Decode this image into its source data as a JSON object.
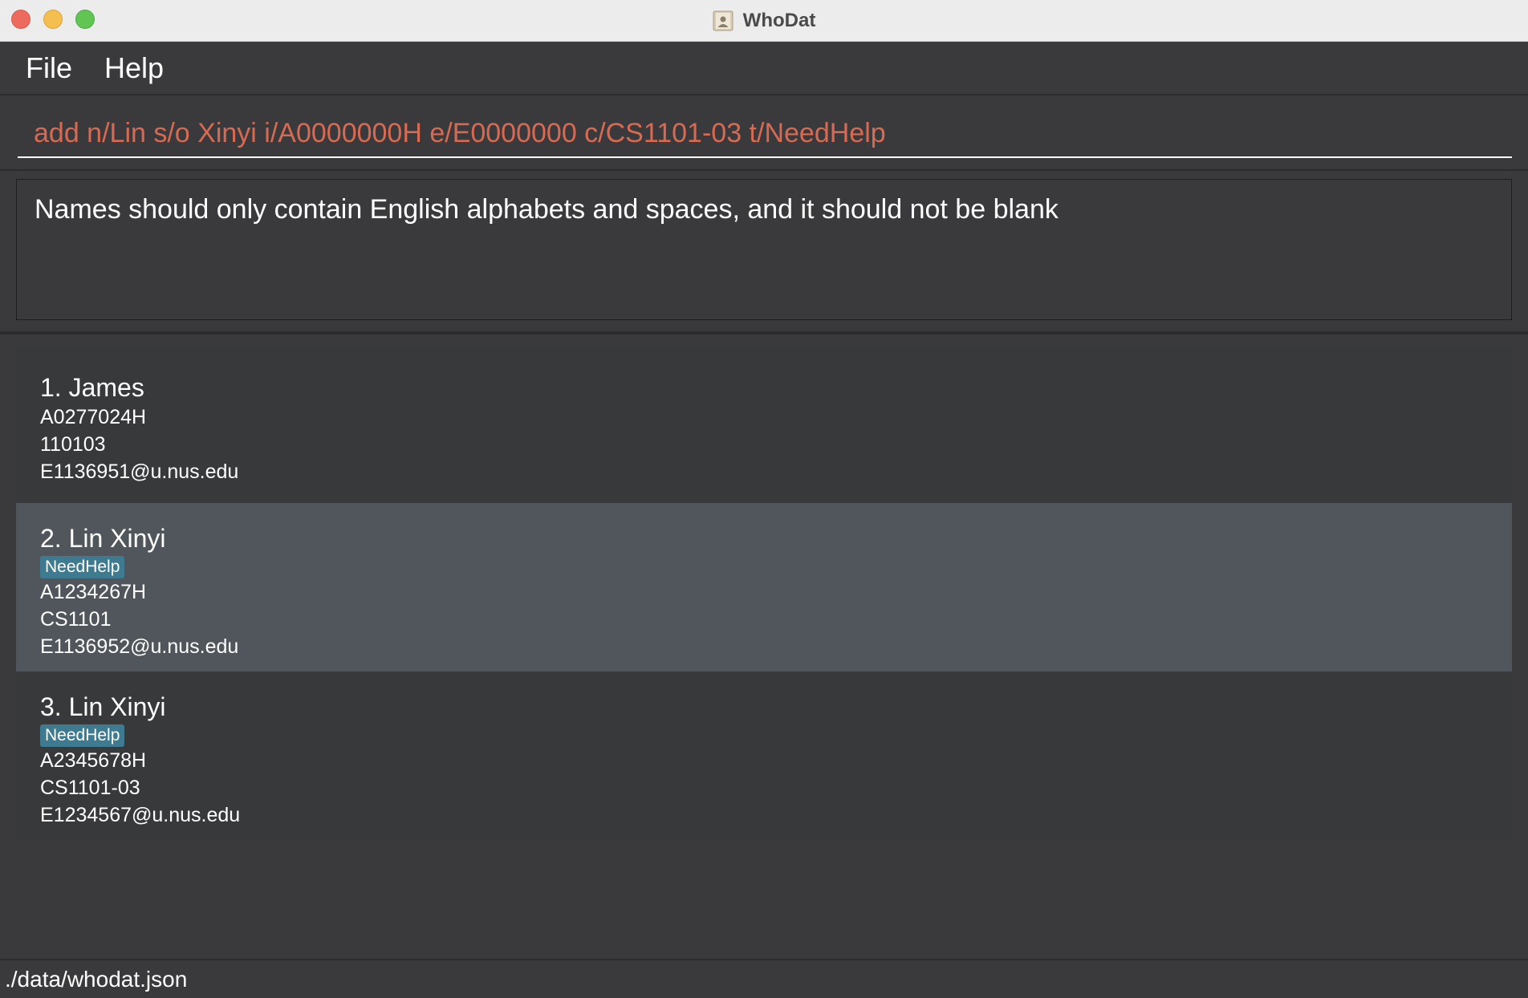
{
  "window": {
    "title": "WhoDat",
    "app_icon": "contacts-app-icon"
  },
  "menu": {
    "items": [
      "File",
      "Help"
    ]
  },
  "command": {
    "value": "add n/Lin s/o Xinyi i/A0000000H e/E0000000 c/CS1101-03 t/NeedHelp",
    "error_color": "#d76a52"
  },
  "result": {
    "message": "Names should only contain English alphabets and spaces, and it should not be blank"
  },
  "persons": [
    {
      "index_name": "1. James",
      "tags": [],
      "id": "A0277024H",
      "class": "110103",
      "email": "E1136951@u.nus.edu",
      "selected": false
    },
    {
      "index_name": "2. Lin Xinyi",
      "tags": [
        "NeedHelp"
      ],
      "id": "A1234267H",
      "class": "CS1101",
      "email": "E1136952@u.nus.edu",
      "selected": true
    },
    {
      "index_name": "3. Lin Xinyi",
      "tags": [
        "NeedHelp"
      ],
      "id": "A2345678H",
      "class": "CS1101-03",
      "email": "E1234567@u.nus.edu",
      "selected": false
    }
  ],
  "status": {
    "file_path": "./data/whodat.json"
  },
  "colors": {
    "tag_bg": "#3e7b91",
    "selected_row": "#50565b",
    "background": "#3a3a3c"
  }
}
